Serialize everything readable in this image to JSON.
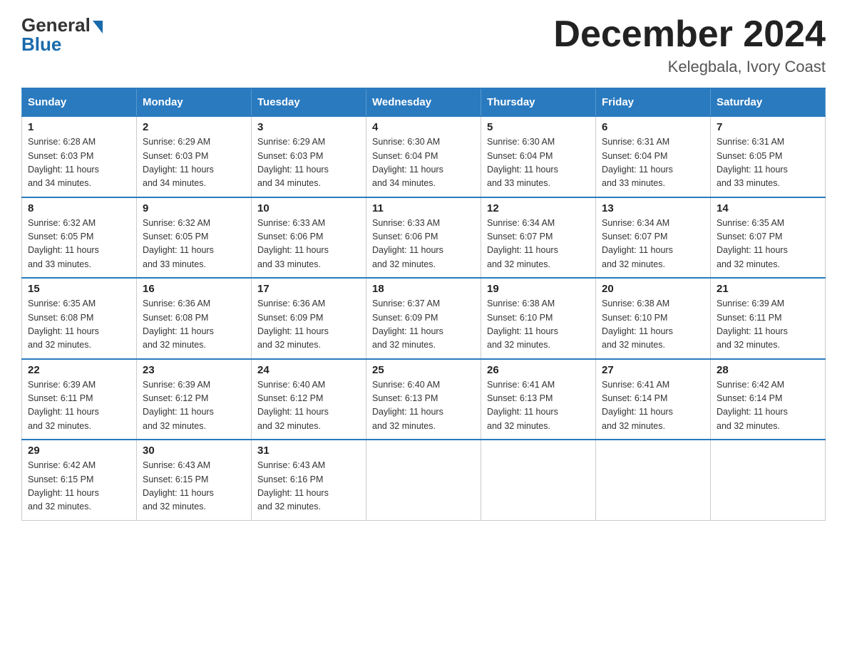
{
  "logo": {
    "general": "General",
    "blue": "Blue"
  },
  "title": "December 2024",
  "subtitle": "Kelegbala, Ivory Coast",
  "days_of_week": [
    "Sunday",
    "Monday",
    "Tuesday",
    "Wednesday",
    "Thursday",
    "Friday",
    "Saturday"
  ],
  "weeks": [
    [
      {
        "day": "1",
        "sunrise": "6:28 AM",
        "sunset": "6:03 PM",
        "daylight": "11 hours and 34 minutes."
      },
      {
        "day": "2",
        "sunrise": "6:29 AM",
        "sunset": "6:03 PM",
        "daylight": "11 hours and 34 minutes."
      },
      {
        "day": "3",
        "sunrise": "6:29 AM",
        "sunset": "6:03 PM",
        "daylight": "11 hours and 34 minutes."
      },
      {
        "day": "4",
        "sunrise": "6:30 AM",
        "sunset": "6:04 PM",
        "daylight": "11 hours and 34 minutes."
      },
      {
        "day": "5",
        "sunrise": "6:30 AM",
        "sunset": "6:04 PM",
        "daylight": "11 hours and 33 minutes."
      },
      {
        "day": "6",
        "sunrise": "6:31 AM",
        "sunset": "6:04 PM",
        "daylight": "11 hours and 33 minutes."
      },
      {
        "day": "7",
        "sunrise": "6:31 AM",
        "sunset": "6:05 PM",
        "daylight": "11 hours and 33 minutes."
      }
    ],
    [
      {
        "day": "8",
        "sunrise": "6:32 AM",
        "sunset": "6:05 PM",
        "daylight": "11 hours and 33 minutes."
      },
      {
        "day": "9",
        "sunrise": "6:32 AM",
        "sunset": "6:05 PM",
        "daylight": "11 hours and 33 minutes."
      },
      {
        "day": "10",
        "sunrise": "6:33 AM",
        "sunset": "6:06 PM",
        "daylight": "11 hours and 33 minutes."
      },
      {
        "day": "11",
        "sunrise": "6:33 AM",
        "sunset": "6:06 PM",
        "daylight": "11 hours and 32 minutes."
      },
      {
        "day": "12",
        "sunrise": "6:34 AM",
        "sunset": "6:07 PM",
        "daylight": "11 hours and 32 minutes."
      },
      {
        "day": "13",
        "sunrise": "6:34 AM",
        "sunset": "6:07 PM",
        "daylight": "11 hours and 32 minutes."
      },
      {
        "day": "14",
        "sunrise": "6:35 AM",
        "sunset": "6:07 PM",
        "daylight": "11 hours and 32 minutes."
      }
    ],
    [
      {
        "day": "15",
        "sunrise": "6:35 AM",
        "sunset": "6:08 PM",
        "daylight": "11 hours and 32 minutes."
      },
      {
        "day": "16",
        "sunrise": "6:36 AM",
        "sunset": "6:08 PM",
        "daylight": "11 hours and 32 minutes."
      },
      {
        "day": "17",
        "sunrise": "6:36 AM",
        "sunset": "6:09 PM",
        "daylight": "11 hours and 32 minutes."
      },
      {
        "day": "18",
        "sunrise": "6:37 AM",
        "sunset": "6:09 PM",
        "daylight": "11 hours and 32 minutes."
      },
      {
        "day": "19",
        "sunrise": "6:38 AM",
        "sunset": "6:10 PM",
        "daylight": "11 hours and 32 minutes."
      },
      {
        "day": "20",
        "sunrise": "6:38 AM",
        "sunset": "6:10 PM",
        "daylight": "11 hours and 32 minutes."
      },
      {
        "day": "21",
        "sunrise": "6:39 AM",
        "sunset": "6:11 PM",
        "daylight": "11 hours and 32 minutes."
      }
    ],
    [
      {
        "day": "22",
        "sunrise": "6:39 AM",
        "sunset": "6:11 PM",
        "daylight": "11 hours and 32 minutes."
      },
      {
        "day": "23",
        "sunrise": "6:39 AM",
        "sunset": "6:12 PM",
        "daylight": "11 hours and 32 minutes."
      },
      {
        "day": "24",
        "sunrise": "6:40 AM",
        "sunset": "6:12 PM",
        "daylight": "11 hours and 32 minutes."
      },
      {
        "day": "25",
        "sunrise": "6:40 AM",
        "sunset": "6:13 PM",
        "daylight": "11 hours and 32 minutes."
      },
      {
        "day": "26",
        "sunrise": "6:41 AM",
        "sunset": "6:13 PM",
        "daylight": "11 hours and 32 minutes."
      },
      {
        "day": "27",
        "sunrise": "6:41 AM",
        "sunset": "6:14 PM",
        "daylight": "11 hours and 32 minutes."
      },
      {
        "day": "28",
        "sunrise": "6:42 AM",
        "sunset": "6:14 PM",
        "daylight": "11 hours and 32 minutes."
      }
    ],
    [
      {
        "day": "29",
        "sunrise": "6:42 AM",
        "sunset": "6:15 PM",
        "daylight": "11 hours and 32 minutes."
      },
      {
        "day": "30",
        "sunrise": "6:43 AM",
        "sunset": "6:15 PM",
        "daylight": "11 hours and 32 minutes."
      },
      {
        "day": "31",
        "sunrise": "6:43 AM",
        "sunset": "6:16 PM",
        "daylight": "11 hours and 32 minutes."
      },
      null,
      null,
      null,
      null
    ]
  ],
  "labels": {
    "sunrise": "Sunrise:",
    "sunset": "Sunset:",
    "daylight": "Daylight:"
  }
}
